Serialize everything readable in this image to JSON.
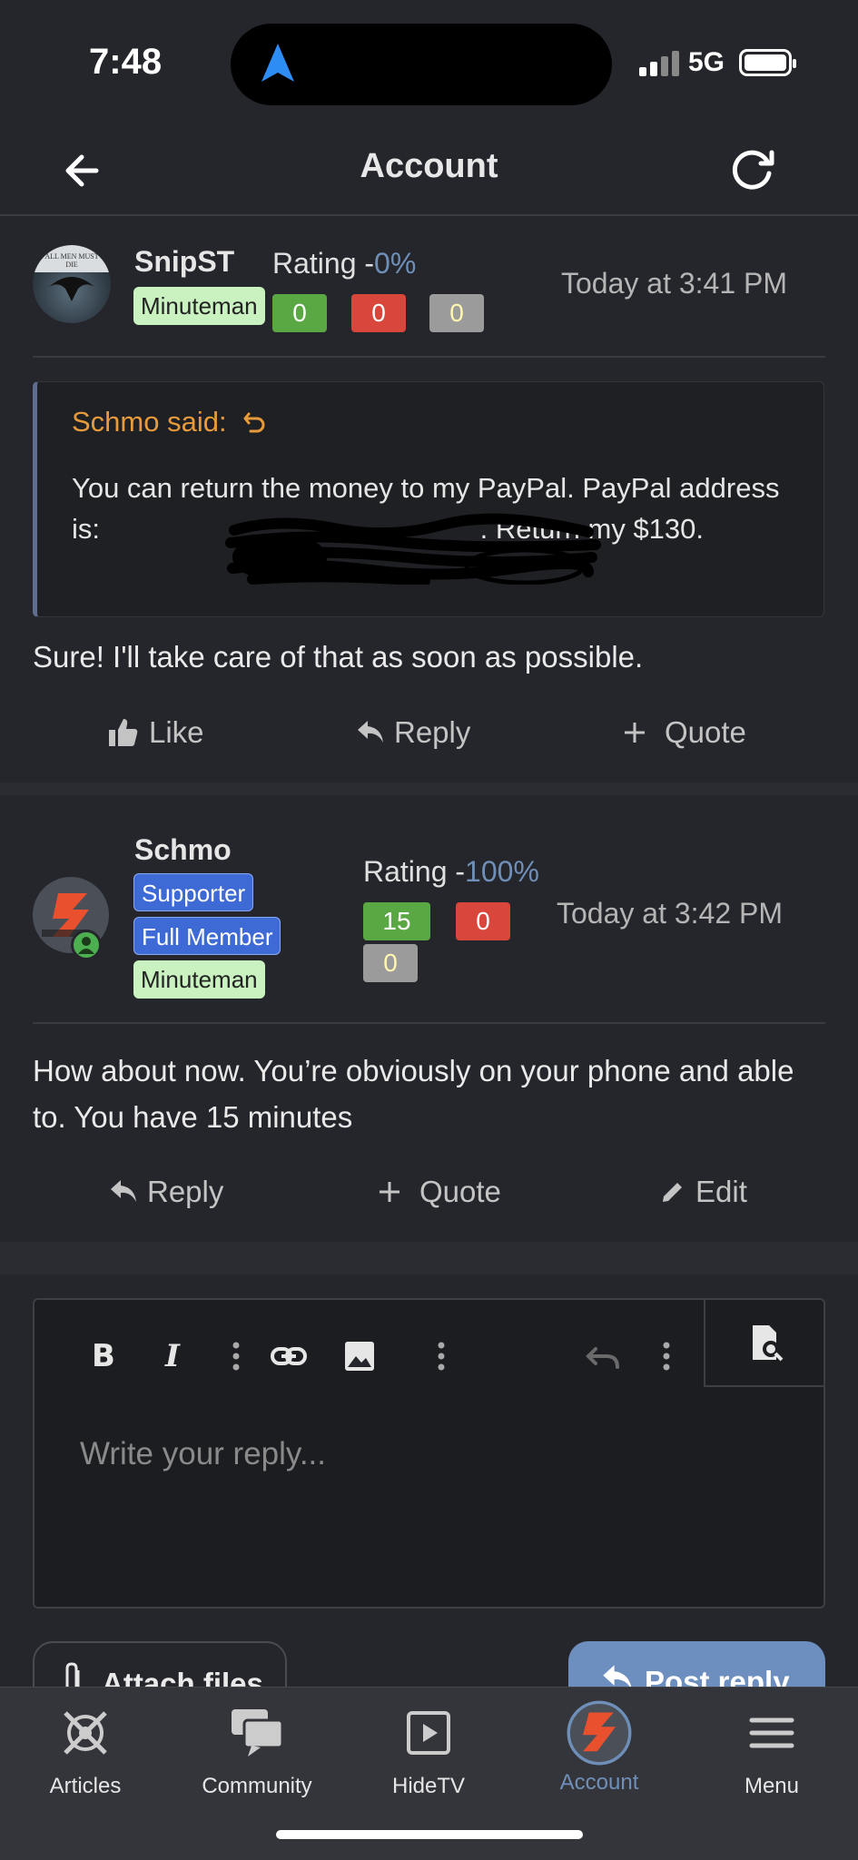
{
  "status_bar": {
    "time": "7:48",
    "network": "5G"
  },
  "header": {
    "title": "Account"
  },
  "posts": [
    {
      "username": "SnipST",
      "avatar_text": "ALL MEN MUST DIE",
      "rating_label": "Rating -",
      "rating_pct": "0%",
      "badges": [
        "Minuteman"
      ],
      "reactions": {
        "positive": "0",
        "negative": "0",
        "neutral": "0"
      },
      "date": "Today at 3:41 PM",
      "quote": {
        "author": "Schmo said:",
        "text_before": "You can return the money to my PayPal. PayPal address is: ",
        "text_after": ". Return my $130."
      },
      "body": "Sure! I'll take care of that as soon as possible.",
      "actions": {
        "like": "Like",
        "reply": "Reply",
        "quote": "Quote"
      }
    },
    {
      "username": "Schmo",
      "rating_label": "Rating -",
      "rating_pct": "100%",
      "badges": [
        "Supporter",
        "Full Member",
        "Minuteman"
      ],
      "reactions": {
        "positive": "15",
        "negative": "0",
        "neutral": "0"
      },
      "date": "Today at 3:42 PM",
      "body": "How about now. You’re obviously on your phone and able to. You have 15 minutes",
      "actions": {
        "reply": "Reply",
        "quote": "Quote",
        "edit": "Edit"
      }
    }
  ],
  "editor": {
    "placeholder": "Write your reply...",
    "toolbar": [
      "bold-icon",
      "italic-icon",
      "more-vertical-icon",
      "link-icon",
      "image-icon",
      "more-vertical-icon",
      "undo-icon",
      "more-vertical-icon",
      "preview-icon"
    ],
    "bold_label": "B",
    "italic_label": "I",
    "attach_label": "Attach files",
    "post_label": "Post reply"
  },
  "tabbar": {
    "items": [
      {
        "label": "Articles",
        "icon": "articles-logo-icon"
      },
      {
        "label": "Community",
        "icon": "chat-bubbles-icon"
      },
      {
        "label": "HideTV",
        "icon": "play-icon"
      },
      {
        "label": "Account",
        "icon": "avatar-icon",
        "active": true
      },
      {
        "label": "Menu",
        "icon": "hamburger-icon"
      }
    ]
  },
  "colors": {
    "background": "#25262b",
    "accent": "#6f8fb8",
    "positive": "#5aa843",
    "negative": "#d9463b",
    "neutral": "#9b9b9b",
    "quote_author": "#e89b3b"
  }
}
